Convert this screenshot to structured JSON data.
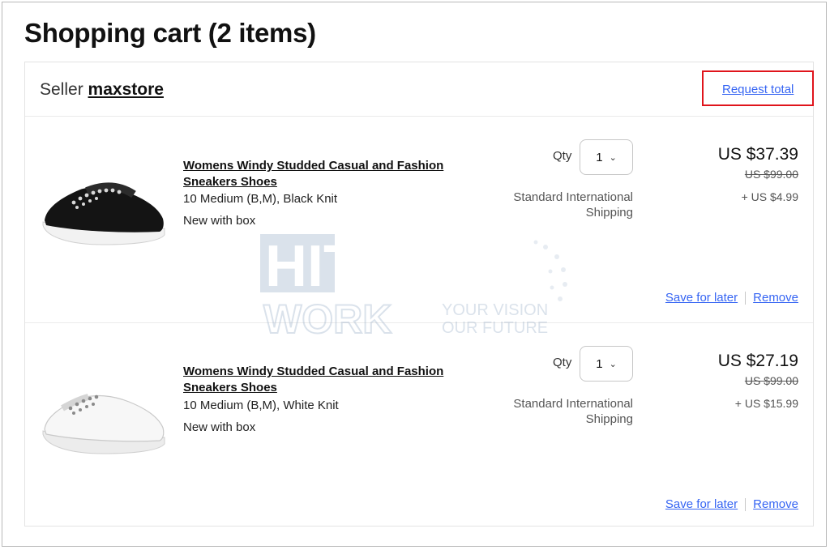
{
  "page": {
    "title": "Shopping cart (2 items)"
  },
  "seller": {
    "label": "Seller",
    "name": "maxstore",
    "request_total": "Request total"
  },
  "items": [
    {
      "title": "Womens Windy Studded Casual and Fashion Sneakers Shoes",
      "variant": "10 Medium (B,M), Black Knit",
      "condition": "New with box",
      "qty_label": "Qty",
      "qty_value": "1",
      "shipping": "Standard International Shipping",
      "price": "US $37.39",
      "original_price": "US $99.00",
      "shipping_cost": "+ US $4.99",
      "save_for_later": "Save for later",
      "remove": "Remove",
      "image_icon": "black-knit-sneaker"
    },
    {
      "title": "Womens Windy Studded Casual and Fashion Sneakers Shoes",
      "variant": "10 Medium (B,M), White Knit",
      "condition": "New with box",
      "qty_label": "Qty",
      "qty_value": "1",
      "shipping": "Standard International Shipping",
      "price": "US $27.19",
      "original_price": "US $99.00",
      "shipping_cost": "+ US $15.99",
      "save_for_later": "Save for later",
      "remove": "Remove",
      "image_icon": "white-knit-sneaker"
    }
  ],
  "watermark": {
    "line1": "HITECH",
    "line2": "WORK",
    "tagline1": "YOUR VISION",
    "tagline2": "OUR FUTURE"
  },
  "colors": {
    "link": "#3665f3",
    "highlight": "#e0141b",
    "text": "#111111"
  }
}
